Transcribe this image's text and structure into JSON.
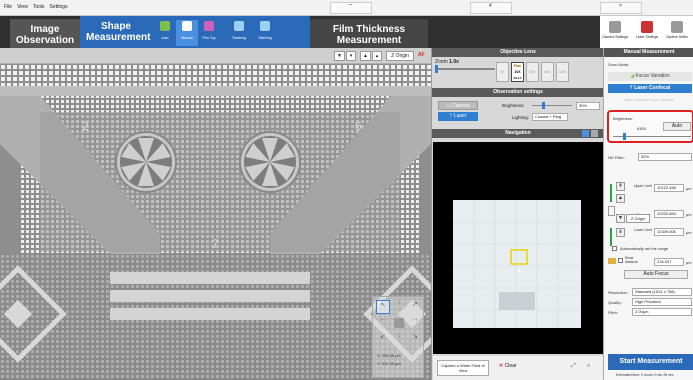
{
  "menu": {
    "items": [
      "File",
      "View",
      "Tools",
      "Settings"
    ]
  },
  "modes": {
    "image_observation": "Image\nObservation",
    "shape_measurement": "Shape\nMeasurement",
    "film_thickness": "Film Thickness\nMeasurement",
    "sub_tools": [
      "Auto",
      "Manual",
      "Film Top",
      "Teaching",
      "Stitching"
    ]
  },
  "top_right": {
    "camera_settings": "Camera Settings",
    "laser_settings": "Laser Settings",
    "system_settings": "System Settin"
  },
  "image_toolbar": {
    "z_origin": "Z Origin",
    "af": "AF"
  },
  "stage_readout": {
    "x": "296.36",
    "y": "331.33",
    "unit": "μm"
  },
  "objective": {
    "header": "Objective Lens",
    "zoom_label": "Zoom",
    "zoom_value": "1.0x",
    "lenses": [
      {
        "label": "5X"
      },
      {
        "label": "10X",
        "sub": "Plan",
        "na": "NA 0.3",
        "selected": true
      },
      {
        "label": "20X"
      },
      {
        "label": "50X"
      },
      {
        "label": "110X"
      }
    ]
  },
  "observation": {
    "header": "Observation settings",
    "camera": "Camera",
    "laser": "Laser",
    "brightness_label": "Brightness:",
    "brightness_value": "30%",
    "lighting_label": "Lighting:",
    "lighting_value": "Coaxial + Ring"
  },
  "navigation": {
    "header": "Navigation",
    "capture_btn": "Capture a Wider Field of View",
    "clear_btn": "Clear"
  },
  "manual": {
    "header": "Manual Measurement",
    "scan_mode_label": "Scan Mode:",
    "focus_variation": "Focus Variation",
    "laser_confocal": "Laser Confocal",
    "faded_option": "Laser Confocal+Focus Variation",
    "brightness_label": "Brightness:",
    "brightness_value": "6300",
    "auto_btn": "Auto",
    "nd_filter_label": "ND Filter:",
    "nd_filter_value": "30%",
    "upper_limit_label": "Upper Limit",
    "upper_limit_value": "10122.468",
    "z_origin_btn": "Z Origin",
    "current_label": "Current:",
    "current_value": "10232.864",
    "lower_limit_label": "Lower Limit",
    "lower_limit_value": "10339.505",
    "unit": "μm",
    "auto_range_label": "Automatically set the range",
    "read_distance_label": "Read distance",
    "read_distance_value": "216.537",
    "auto_focus_btn": "Auto Focus",
    "resolution_label": "Resolution:",
    "resolution_value": "Standard (1024 x 768)",
    "quality_label": "Quality:",
    "quality_value": "High Precision",
    "pitch_label": "Pitch:",
    "pitch_value": "2.00μm",
    "start_btn": "Start Measurement",
    "estimated_time": "Estimated time: 0 hours 0 min 28 sec"
  },
  "colors": {
    "accent": "#2a6ab9",
    "header_dark": "#2f2f2f",
    "highlight_red": "#e02020",
    "nav_rect": "#e8d400"
  }
}
